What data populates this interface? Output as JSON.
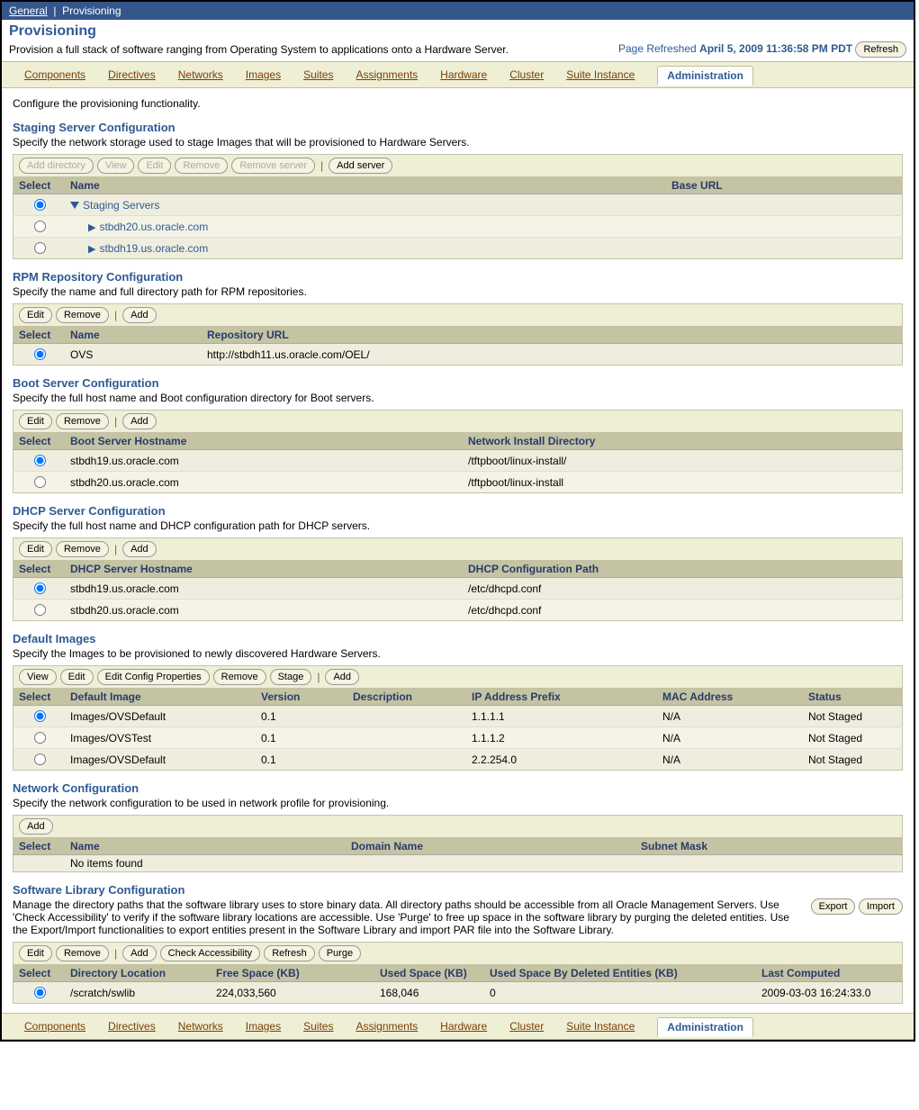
{
  "topbar": {
    "general": "General",
    "provisioning": "Provisioning"
  },
  "header": {
    "title": "Provisioning",
    "subtitle": "Provision a full stack of software ranging from Operating System to applications onto a Hardware Server.",
    "refreshed_label": "Page Refreshed ",
    "refreshed_date": "April 5, 2009 11:36:58 PM PDT",
    "refresh_btn": "Refresh"
  },
  "tabs": {
    "components": "Components",
    "directives": "Directives",
    "networks": "Networks",
    "images": "Images",
    "suites": "Suites",
    "assignments": "Assignments",
    "hardware": "Hardware",
    "cluster": "Cluster",
    "suite_instance": "Suite Instance",
    "administration": "Administration"
  },
  "intro": "Configure the provisioning functionality.",
  "staging": {
    "title": "Staging Server Configuration",
    "desc": "Specify the network storage used to stage Images that will be provisioned to Hardware Servers.",
    "btns": {
      "add_dir": "Add directory",
      "view": "View",
      "edit": "Edit",
      "remove": "Remove",
      "remove_server": "Remove server",
      "add_server": "Add server"
    },
    "headers": {
      "select": "Select",
      "name": "Name",
      "baseurl": "Base URL"
    },
    "rows": [
      {
        "name": "Staging Servers",
        "baseurl": "",
        "selected": true,
        "type": "root"
      },
      {
        "name": "stbdh20.us.oracle.com",
        "baseurl": "",
        "selected": false,
        "type": "child"
      },
      {
        "name": "stbdh19.us.oracle.com",
        "baseurl": "",
        "selected": false,
        "type": "child"
      }
    ]
  },
  "rpm": {
    "title": "RPM Repository Configuration",
    "desc": "Specify the name and full directory path for RPM repositories.",
    "btns": {
      "edit": "Edit",
      "remove": "Remove",
      "add": "Add"
    },
    "headers": {
      "select": "Select",
      "name": "Name",
      "url": "Repository URL"
    },
    "rows": [
      {
        "name": "OVS",
        "url": "http://stbdh11.us.oracle.com/OEL/",
        "selected": true
      }
    ]
  },
  "boot": {
    "title": "Boot Server Configuration",
    "desc": "Specify the full host name and Boot configuration directory for Boot servers.",
    "btns": {
      "edit": "Edit",
      "remove": "Remove",
      "add": "Add"
    },
    "headers": {
      "select": "Select",
      "host": "Boot Server Hostname",
      "dir": "Network Install Directory"
    },
    "rows": [
      {
        "host": "stbdh19.us.oracle.com",
        "dir": "/tftpboot/linux-install/",
        "selected": true
      },
      {
        "host": "stbdh20.us.oracle.com",
        "dir": "/tftpboot/linux-install",
        "selected": false
      }
    ]
  },
  "dhcp": {
    "title": "DHCP Server Configuration",
    "desc": "Specify the full host name and DHCP configuration path for DHCP servers.",
    "btns": {
      "edit": "Edit",
      "remove": "Remove",
      "add": "Add"
    },
    "headers": {
      "select": "Select",
      "host": "DHCP Server Hostname",
      "path": "DHCP Configuration Path"
    },
    "rows": [
      {
        "host": "stbdh19.us.oracle.com",
        "path": "/etc/dhcpd.conf",
        "selected": true
      },
      {
        "host": "stbdh20.us.oracle.com",
        "path": "/etc/dhcpd.conf",
        "selected": false
      }
    ]
  },
  "images": {
    "title": "Default Images",
    "desc": "Specify the Images to be provisioned to newly discovered Hardware Servers.",
    "btns": {
      "view": "View",
      "edit": "Edit",
      "ecp": "Edit Config Properties",
      "remove": "Remove",
      "stage": "Stage",
      "add": "Add"
    },
    "headers": {
      "select": "Select",
      "image": "Default Image",
      "version": "Version",
      "desc": "Description",
      "ip": "IP Address Prefix",
      "mac": "MAC Address",
      "status": "Status"
    },
    "rows": [
      {
        "image": "Images/OVSDefault",
        "version": "0.1",
        "desc": "",
        "ip": "1.1.1.1",
        "mac": "N/A",
        "status": "Not Staged",
        "selected": true
      },
      {
        "image": "Images/OVSTest",
        "version": "0.1",
        "desc": "",
        "ip": "1.1.1.2",
        "mac": "N/A",
        "status": "Not Staged",
        "selected": false
      },
      {
        "image": "Images/OVSDefault",
        "version": "0.1",
        "desc": "",
        "ip": "2.2.254.0",
        "mac": "N/A",
        "status": "Not Staged",
        "selected": false
      }
    ]
  },
  "network": {
    "title": "Network Configuration",
    "desc": "Specify the network configuration to be used in network profile for provisioning.",
    "btns": {
      "add": "Add"
    },
    "headers": {
      "select": "Select",
      "name": "Name",
      "domain": "Domain Name",
      "subnet": "Subnet Mask"
    },
    "empty": "No items found"
  },
  "swlib": {
    "title": "Software Library Configuration",
    "desc": "Manage the directory paths that the software library uses to store binary data. All directory paths should be accessible from all Oracle Management Servers. Use 'Check Accessibility' to verify if the software library locations are accessible. Use 'Purge' to free up space in the software library by purging the deleted entities. Use the Export/Import functionalities to export entities present in the Software Library and import PAR file into the Software Library.",
    "btns": {
      "export": "Export",
      "import": "Import",
      "edit": "Edit",
      "remove": "Remove",
      "add": "Add",
      "check": "Check Accessibility",
      "refresh": "Refresh",
      "purge": "Purge"
    },
    "headers": {
      "select": "Select",
      "loc": "Directory Location",
      "free": "Free Space (KB)",
      "used": "Used Space (KB)",
      "usedDel": "Used Space By Deleted Entities (KB)",
      "last": "Last Computed"
    },
    "rows": [
      {
        "loc": "/scratch/swlib",
        "free": "224,033,560",
        "used": "168,046",
        "usedDel": "0",
        "last": "2009-03-03 16:24:33.0",
        "selected": true
      }
    ]
  }
}
